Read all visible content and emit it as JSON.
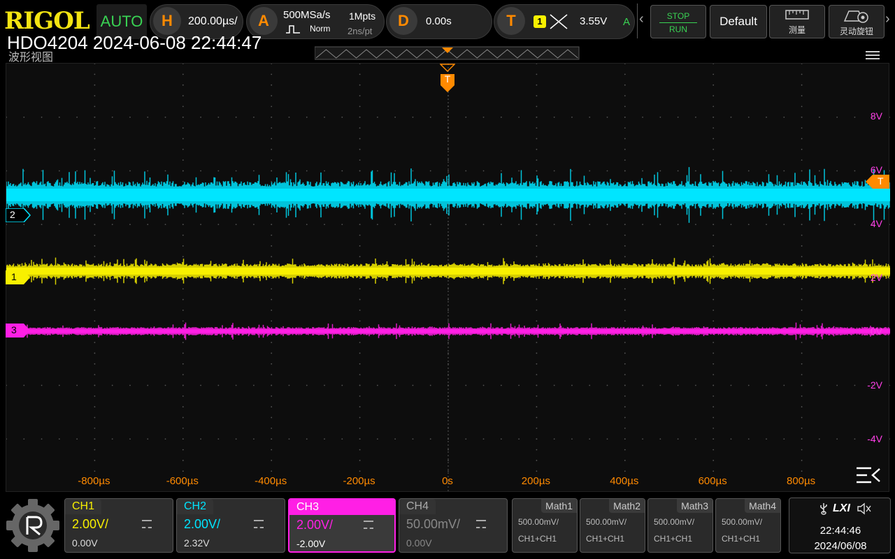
{
  "header": {
    "logo": "RIGOL",
    "mode": "AUTO",
    "horizontal": {
      "letter": "H",
      "value": "200.00µs/"
    },
    "acquire": {
      "letter": "A",
      "rate": "500MSa/s",
      "mode": "Norm",
      "memory": "1Mpts",
      "period": "2ns/pt"
    },
    "delay": {
      "letter": "D",
      "value": "0.00s"
    },
    "trigger": {
      "letter": "T",
      "source": "1",
      "level": "3.55V",
      "status": "A"
    },
    "stop_run": {
      "stop": "STOP",
      "run": "RUN"
    },
    "default_label": "Default",
    "measure_label": "测量",
    "knob_label": "灵动旋钮"
  },
  "overlay": {
    "device_timestamp": "HDO4204 2024-06-08 22:44:47",
    "view_title": "波形视图"
  },
  "trigger_marker": "T",
  "right_axis": [
    "8V",
    "6V",
    "4V",
    "2V",
    "0V",
    "-2V",
    "-4V"
  ],
  "time_axis": [
    "-800µs",
    "-600µs",
    "-400µs",
    "-200µs",
    "0s",
    "200µs",
    "400µs",
    "600µs",
    "800µs"
  ],
  "channels_markers": [
    {
      "label": "2",
      "color": "#00e5ff"
    },
    {
      "label": "1",
      "color": "#f8f000"
    },
    {
      "label": "3",
      "color": "#ff1fe5"
    }
  ],
  "trigger_level_marker": "T",
  "colors": {
    "ch1": "#f8f000",
    "ch2": "#00e5ff",
    "ch3": "#ff1fe5",
    "ch4": "#8a8a8a",
    "accent": "#ff8a00",
    "axis": "#ff3fe8"
  },
  "channels": [
    {
      "name": "CH1",
      "scale": "2.00V/",
      "offset": "0.00V"
    },
    {
      "name": "CH2",
      "scale": "2.00V/",
      "offset": "2.32V"
    },
    {
      "name": "CH3",
      "scale": "2.00V/",
      "offset": "-2.00V"
    },
    {
      "name": "CH4",
      "scale": "50.00mV/",
      "offset": "0.00V"
    }
  ],
  "math": [
    {
      "name": "Math1",
      "scale": "500.00mV/",
      "expr": "CH1+CH1"
    },
    {
      "name": "Math2",
      "scale": "500.00mV/",
      "expr": "CH1+CH1"
    },
    {
      "name": "Math3",
      "scale": "500.00mV/",
      "expr": "CH1+CH1"
    },
    {
      "name": "Math4",
      "scale": "500.00mV/",
      "expr": "CH1+CH1"
    }
  ],
  "status": {
    "lxi": "LXI",
    "time": "22:44:46",
    "date": "2024/06/08"
  }
}
